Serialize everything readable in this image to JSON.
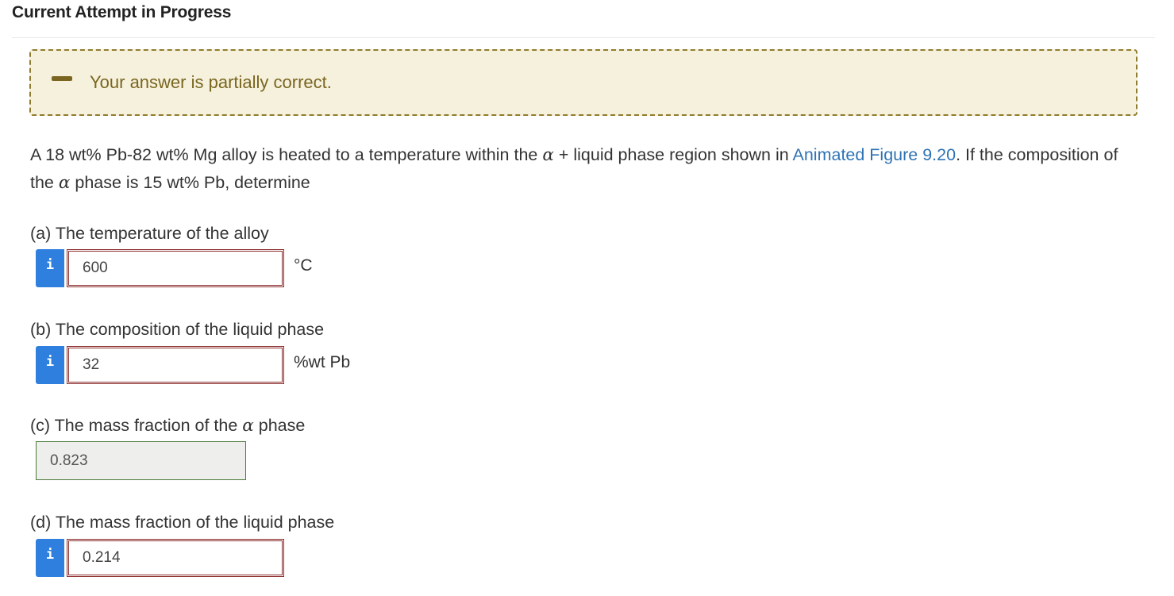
{
  "header": {
    "title": "Current Attempt in Progress"
  },
  "feedback": {
    "message": "Your answer is partially correct.",
    "status": "partial",
    "color": "#7a6621"
  },
  "question": {
    "intro_before_link": "A 18 wt% Pb-82 wt% Mg alloy is heated to a temperature within the ",
    "alpha": "α",
    "intro_mid": " + liquid phase region shown in ",
    "link_text": "Animated Figure 9.20",
    "intro_after_link": ". If the composition of the ",
    "intro_end": " phase is 15 wt% Pb, determine"
  },
  "parts": [
    {
      "label": "(a) The temperature of the alloy",
      "value": "600",
      "unit": "°C",
      "status": "incorrect"
    },
    {
      "label": "(b) The composition of the liquid phase",
      "value": "32",
      "unit": "%wt Pb",
      "status": "incorrect"
    },
    {
      "label_before": "(c) The mass fraction of the ",
      "label_alpha": "α",
      "label_after": " phase",
      "value": "0.823",
      "status": "correct"
    },
    {
      "label": "(d) The mass fraction of the liquid phase",
      "value": "0.214",
      "status": "incorrect"
    }
  ],
  "info_icon_glyph": "i",
  "colors": {
    "link": "#2f73b5",
    "info_button": "#2f80de",
    "incorrect_border": "#8b2b2b",
    "correct_border": "#4a7a3a"
  }
}
